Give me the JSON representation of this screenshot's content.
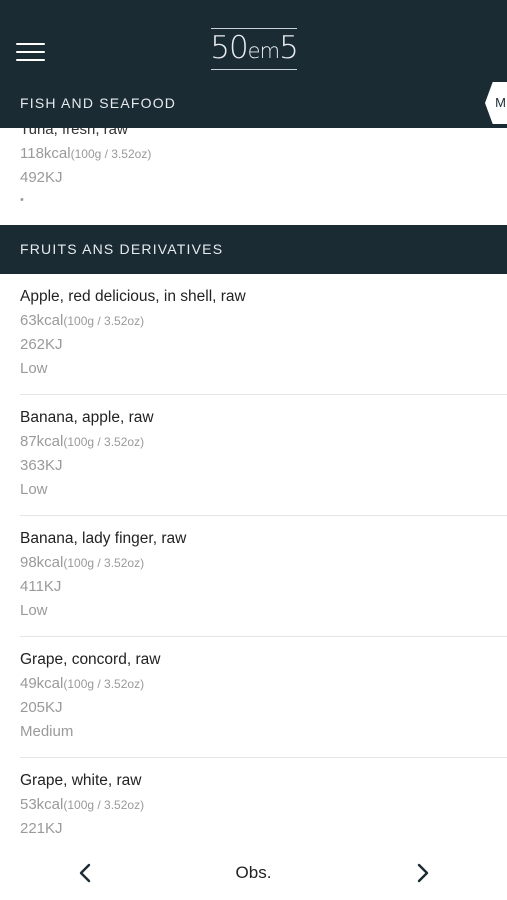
{
  "app": {
    "logo_big_left": "50",
    "logo_small": "em",
    "logo_big_right": "5"
  },
  "sections": {
    "fish": {
      "title": "FISH AND SEAFOOD",
      "tab_label": "M",
      "partial_item": {
        "name": "Tuna, fresh, raw",
        "kcal": "118kcal",
        "portion": "(100g / 3.52oz)",
        "kj": "492KJ",
        "level": "•"
      }
    },
    "fruits": {
      "title": "FRUITS ANS DERIVATIVES",
      "items": [
        {
          "name": "Apple, red delicious, in shell, raw",
          "kcal": "63kcal",
          "portion": "(100g / 3.52oz)",
          "kj": "262KJ",
          "level": "Low"
        },
        {
          "name": "Banana, apple, raw",
          "kcal": "87kcal",
          "portion": "(100g / 3.52oz)",
          "kj": "363KJ",
          "level": "Low"
        },
        {
          "name": "Banana, lady finger, raw",
          "kcal": "98kcal",
          "portion": "(100g / 3.52oz)",
          "kj": "411KJ",
          "level": "Low"
        },
        {
          "name": "Grape, concord, raw",
          "kcal": "49kcal",
          "portion": "(100g / 3.52oz)",
          "kj": "205KJ",
          "level": "Medium"
        },
        {
          "name": "Grape, white, raw",
          "kcal": "53kcal",
          "portion": "(100g / 3.52oz)",
          "kj": "221KJ",
          "level": ""
        }
      ]
    }
  },
  "bottom_nav": {
    "center_label": "Obs.",
    "prev_icon": "chevron-left-icon",
    "next_icon": "chevron-right-icon"
  },
  "colors": {
    "header_bg": "#1b2b34",
    "muted_text": "#9a9a9a"
  }
}
